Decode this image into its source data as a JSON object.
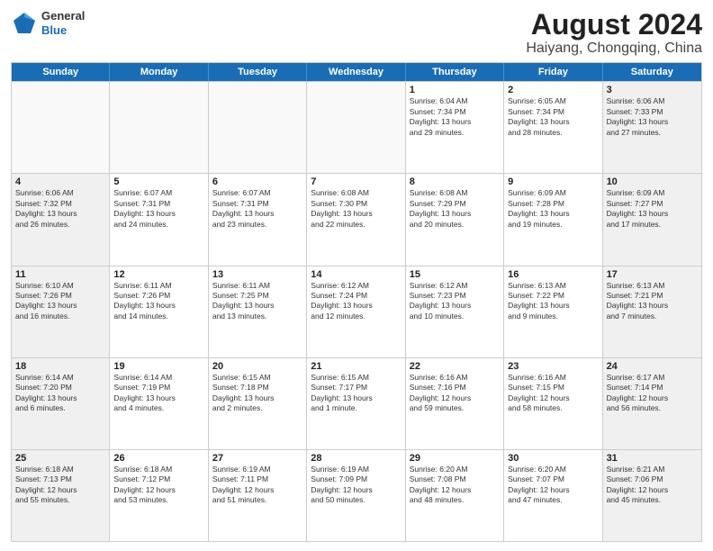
{
  "header": {
    "logo_general": "General",
    "logo_blue": "Blue",
    "title": "August 2024",
    "subtitle": "Haiyang, Chongqing, China"
  },
  "weekdays": [
    "Sunday",
    "Monday",
    "Tuesday",
    "Wednesday",
    "Thursday",
    "Friday",
    "Saturday"
  ],
  "weeks": [
    [
      {
        "day": "",
        "text": "",
        "empty": true
      },
      {
        "day": "",
        "text": "",
        "empty": true
      },
      {
        "day": "",
        "text": "",
        "empty": true
      },
      {
        "day": "",
        "text": "",
        "empty": true
      },
      {
        "day": "1",
        "text": "Sunrise: 6:04 AM\nSunset: 7:34 PM\nDaylight: 13 hours\nand 29 minutes."
      },
      {
        "day": "2",
        "text": "Sunrise: 6:05 AM\nSunset: 7:34 PM\nDaylight: 13 hours\nand 28 minutes."
      },
      {
        "day": "3",
        "text": "Sunrise: 6:06 AM\nSunset: 7:33 PM\nDaylight: 13 hours\nand 27 minutes."
      }
    ],
    [
      {
        "day": "4",
        "text": "Sunrise: 6:06 AM\nSunset: 7:32 PM\nDaylight: 13 hours\nand 26 minutes."
      },
      {
        "day": "5",
        "text": "Sunrise: 6:07 AM\nSunset: 7:31 PM\nDaylight: 13 hours\nand 24 minutes."
      },
      {
        "day": "6",
        "text": "Sunrise: 6:07 AM\nSunset: 7:31 PM\nDaylight: 13 hours\nand 23 minutes."
      },
      {
        "day": "7",
        "text": "Sunrise: 6:08 AM\nSunset: 7:30 PM\nDaylight: 13 hours\nand 22 minutes."
      },
      {
        "day": "8",
        "text": "Sunrise: 6:08 AM\nSunset: 7:29 PM\nDaylight: 13 hours\nand 20 minutes."
      },
      {
        "day": "9",
        "text": "Sunrise: 6:09 AM\nSunset: 7:28 PM\nDaylight: 13 hours\nand 19 minutes."
      },
      {
        "day": "10",
        "text": "Sunrise: 6:09 AM\nSunset: 7:27 PM\nDaylight: 13 hours\nand 17 minutes."
      }
    ],
    [
      {
        "day": "11",
        "text": "Sunrise: 6:10 AM\nSunset: 7:26 PM\nDaylight: 13 hours\nand 16 minutes."
      },
      {
        "day": "12",
        "text": "Sunrise: 6:11 AM\nSunset: 7:26 PM\nDaylight: 13 hours\nand 14 minutes."
      },
      {
        "day": "13",
        "text": "Sunrise: 6:11 AM\nSunset: 7:25 PM\nDaylight: 13 hours\nand 13 minutes."
      },
      {
        "day": "14",
        "text": "Sunrise: 6:12 AM\nSunset: 7:24 PM\nDaylight: 13 hours\nand 12 minutes."
      },
      {
        "day": "15",
        "text": "Sunrise: 6:12 AM\nSunset: 7:23 PM\nDaylight: 13 hours\nand 10 minutes."
      },
      {
        "day": "16",
        "text": "Sunrise: 6:13 AM\nSunset: 7:22 PM\nDaylight: 13 hours\nand 9 minutes."
      },
      {
        "day": "17",
        "text": "Sunrise: 6:13 AM\nSunset: 7:21 PM\nDaylight: 13 hours\nand 7 minutes."
      }
    ],
    [
      {
        "day": "18",
        "text": "Sunrise: 6:14 AM\nSunset: 7:20 PM\nDaylight: 13 hours\nand 6 minutes."
      },
      {
        "day": "19",
        "text": "Sunrise: 6:14 AM\nSunset: 7:19 PM\nDaylight: 13 hours\nand 4 minutes."
      },
      {
        "day": "20",
        "text": "Sunrise: 6:15 AM\nSunset: 7:18 PM\nDaylight: 13 hours\nand 2 minutes."
      },
      {
        "day": "21",
        "text": "Sunrise: 6:15 AM\nSunset: 7:17 PM\nDaylight: 13 hours\nand 1 minute."
      },
      {
        "day": "22",
        "text": "Sunrise: 6:16 AM\nSunset: 7:16 PM\nDaylight: 12 hours\nand 59 minutes."
      },
      {
        "day": "23",
        "text": "Sunrise: 6:16 AM\nSunset: 7:15 PM\nDaylight: 12 hours\nand 58 minutes."
      },
      {
        "day": "24",
        "text": "Sunrise: 6:17 AM\nSunset: 7:14 PM\nDaylight: 12 hours\nand 56 minutes."
      }
    ],
    [
      {
        "day": "25",
        "text": "Sunrise: 6:18 AM\nSunset: 7:13 PM\nDaylight: 12 hours\nand 55 minutes."
      },
      {
        "day": "26",
        "text": "Sunrise: 6:18 AM\nSunset: 7:12 PM\nDaylight: 12 hours\nand 53 minutes."
      },
      {
        "day": "27",
        "text": "Sunrise: 6:19 AM\nSunset: 7:11 PM\nDaylight: 12 hours\nand 51 minutes."
      },
      {
        "day": "28",
        "text": "Sunrise: 6:19 AM\nSunset: 7:09 PM\nDaylight: 12 hours\nand 50 minutes."
      },
      {
        "day": "29",
        "text": "Sunrise: 6:20 AM\nSunset: 7:08 PM\nDaylight: 12 hours\nand 48 minutes."
      },
      {
        "day": "30",
        "text": "Sunrise: 6:20 AM\nSunset: 7:07 PM\nDaylight: 12 hours\nand 47 minutes."
      },
      {
        "day": "31",
        "text": "Sunrise: 6:21 AM\nSunset: 7:06 PM\nDaylight: 12 hours\nand 45 minutes."
      }
    ]
  ]
}
